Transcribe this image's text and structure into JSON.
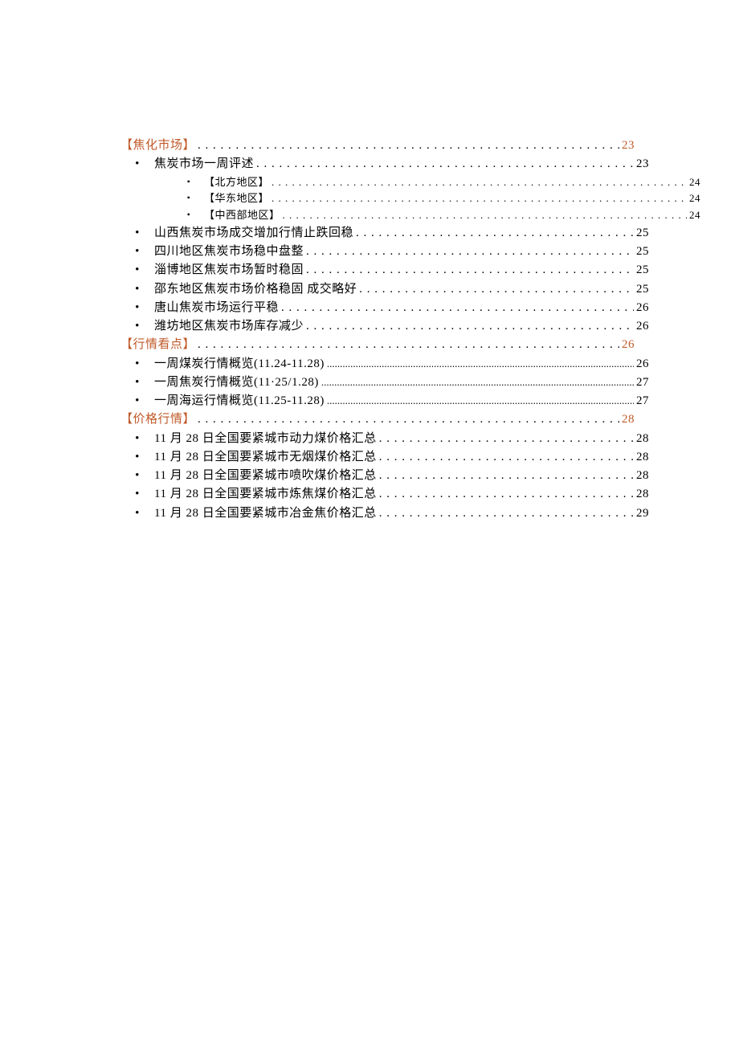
{
  "sections": [
    {
      "title": "【焦化市场】",
      "page": "23",
      "items": [
        {
          "text": "焦炭市场一周评述",
          "page": "23",
          "sub": [
            {
              "text": "【北方地区】",
              "page": "24"
            },
            {
              "text": "【华东地区】",
              "page": "24"
            },
            {
              "text": "【中西部地区】",
              "page": "24"
            }
          ]
        },
        {
          "text": "山西焦炭市场成交增加行情止跌回稳",
          "page": "25"
        },
        {
          "text": "四川地区焦炭市场稳中盘整",
          "page": "25"
        },
        {
          "text": "淄博地区焦炭市场暂时稳固",
          "page": "25"
        },
        {
          "text": "邵东地区焦炭市场价格稳固 成交略好",
          "page": "25"
        },
        {
          "text": "唐山焦炭市场运行平稳",
          "page": "26"
        },
        {
          "text": "潍坊地区焦炭市场库存减少",
          "page": "26"
        }
      ]
    },
    {
      "title": "【行情看点】",
      "page": "26",
      "dense": true,
      "items": [
        {
          "text": "一周煤炭行情概览(11.24-11.28)",
          "page": "26",
          "dense": true
        },
        {
          "text": "一周焦炭行情概览(11·25/1.28)",
          "page": "27",
          "dense": true
        },
        {
          "text": "一周海运行情概览(11.25-11.28)",
          "page": "27",
          "dense": true
        }
      ]
    },
    {
      "title": "【价格行情】",
      "page": "28",
      "items": [
        {
          "text": "11 月 28 日全国要紧城市动力煤价格汇总",
          "page": "28"
        },
        {
          "text": "11 月 28 日全国要紧城市无烟煤价格汇总",
          "page": "28"
        },
        {
          "text": "11 月 28 日全国要紧城市喷吹煤价格汇总",
          "page": "28"
        },
        {
          "text": "11 月 28 日全国要紧城市炼焦煤价格汇总",
          "page": "28"
        },
        {
          "text": "11 月 28 日全国要紧城市冶金焦价格汇总",
          "page": "29"
        }
      ]
    }
  ]
}
